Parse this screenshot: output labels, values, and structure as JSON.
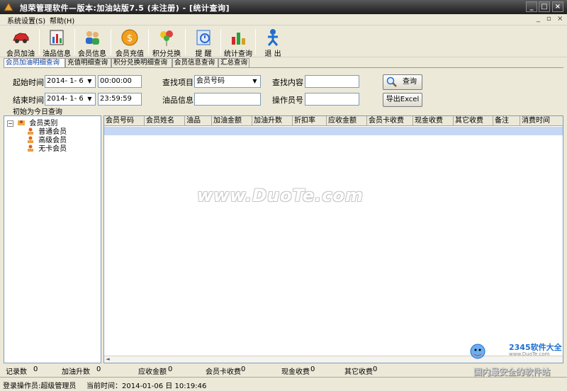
{
  "window": {
    "title": "旭荣管理软件—版本:加油站版7.5 (未注册) - [统计查询]"
  },
  "menu": {
    "items": [
      "系统设置(S)",
      "帮助(H)"
    ],
    "mdi_controls": [
      "_",
      "▫",
      "×"
    ]
  },
  "toolbar": {
    "buttons": [
      {
        "label": "会员加油",
        "icon": "car-icon"
      },
      {
        "label": "油品信息",
        "icon": "fuel-chart-icon"
      },
      {
        "label": "会员信息",
        "icon": "users-icon"
      },
      {
        "label": "会员充值",
        "icon": "coin-icon"
      },
      {
        "label": "积分兑换",
        "icon": "balloons-icon"
      },
      {
        "label": "提 醒",
        "icon": "reminder-icon"
      },
      {
        "label": "统计查询",
        "icon": "stats-icon"
      },
      {
        "label": "退 出",
        "icon": "exit-icon"
      }
    ]
  },
  "tabs": [
    "会员加油明细查询",
    "充值明细查询",
    "积分兑换明细查询",
    "会员信息查询",
    "汇总查询"
  ],
  "query": {
    "start_label": "起始时间",
    "start_date": "2014- 1- 6",
    "start_time": "00:00:00",
    "end_label": "结束时间",
    "end_date": "2014- 1- 6",
    "end_time": "23:59:59",
    "item_label": "查找项目",
    "item_value": "会员号码",
    "content_label": "查找内容",
    "content_value": "",
    "oil_label": "油品信息",
    "oil_value": "",
    "operator_label": "操作员号",
    "operator_value": "",
    "search_button": "查询",
    "export_button": "导出Excel",
    "hint": "初始为今日查询"
  },
  "tree": {
    "root": "会员类别",
    "children": [
      "普通会员",
      "高级会员",
      "无卡会员"
    ]
  },
  "grid": {
    "columns": [
      "会员号码",
      "会员姓名",
      "油品",
      "加油金额",
      "加油升数",
      "折扣率",
      "应收金额",
      "会员卡收费",
      "现金收费",
      "其它收费",
      "备注",
      "消费时间"
    ]
  },
  "summary": {
    "record_count_label": "记录数",
    "record_count": "0",
    "liters_label": "加油升数",
    "liters": "0",
    "receivable_label": "应收金额",
    "receivable": "0",
    "card_label": "会员卡收费",
    "card": "0",
    "cash_label": "现金收费",
    "cash": "0",
    "other_label": "其它收费",
    "other": "0"
  },
  "status": {
    "operator": "登录操作员:超级管理员",
    "time": "当前时间：2014-01-06 日 10:19:46"
  },
  "watermark": "www.DuoTe.com",
  "logo": {
    "brand": "2345软件大全",
    "url": "www.DuoTe.com",
    "slogan": "国内最安全的软件站"
  },
  "colors": {
    "titlebar": "#3a3a3a",
    "selected_row": "#c5d7f2",
    "active_tab_text": "#0a3a9a"
  }
}
